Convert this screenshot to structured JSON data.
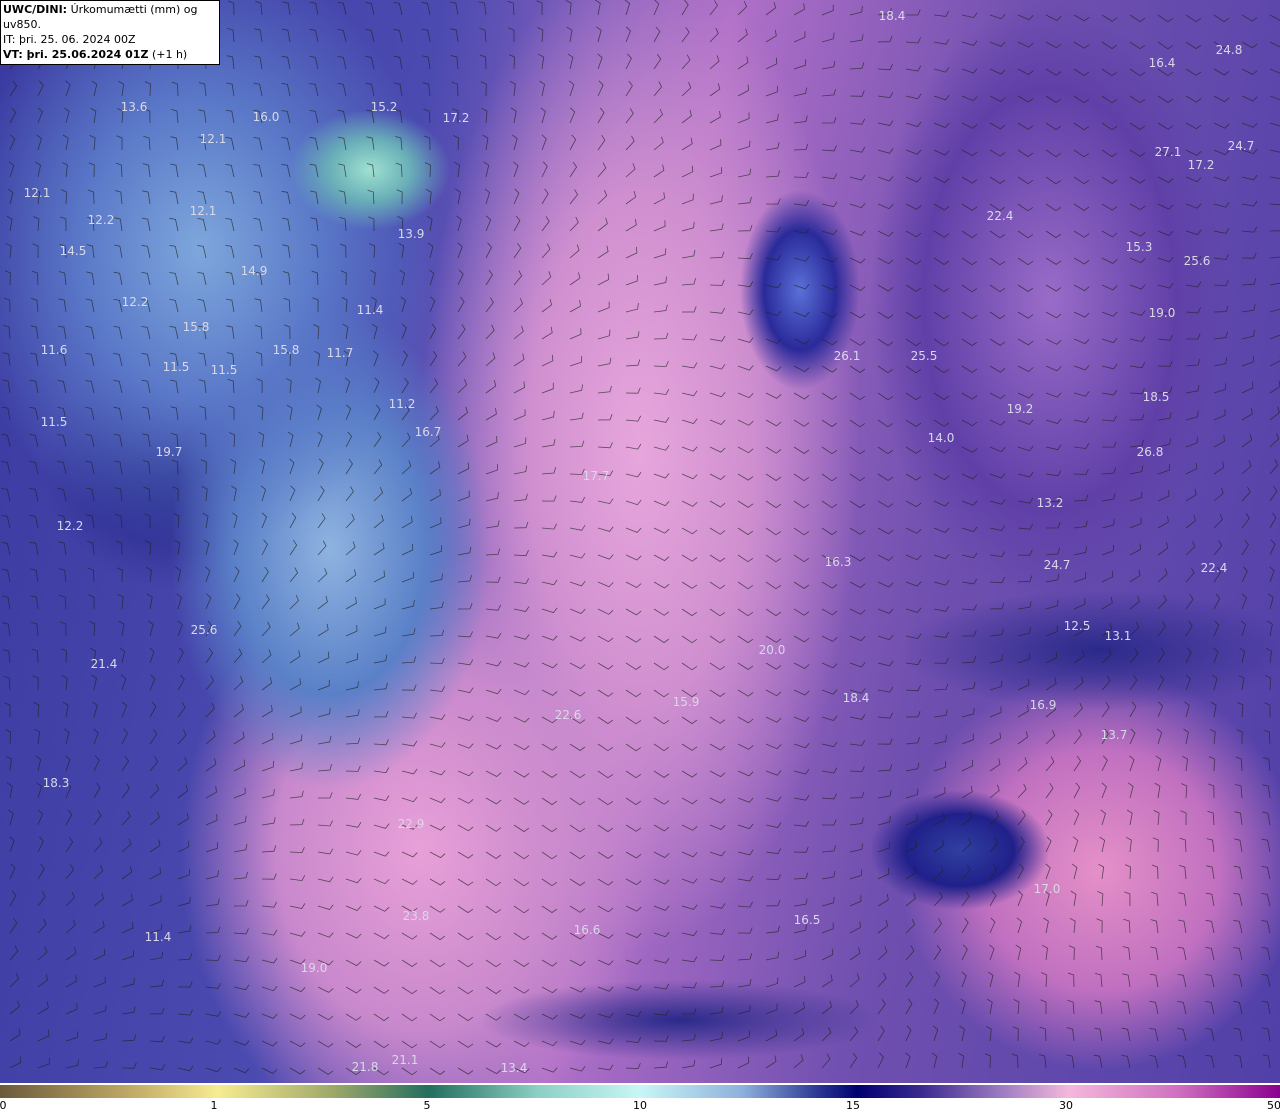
{
  "header": {
    "model": "UWC/DINI:",
    "title": "Úrkomumætti (mm) og uv850.",
    "it": "IT: þri. 25. 06. 2024 00Z",
    "vt_label": "VT: þri. 25.06.2024 01Z",
    "vt_offset": "(+1 h)"
  },
  "colorbar": {
    "ticks": [
      "0",
      "1",
      "5",
      "10",
      "15",
      "30",
      "50"
    ],
    "colors": [
      "#6b5a3a",
      "#f7ec90",
      "#236e5e",
      "#c8f6f6",
      "#000070",
      "#f4b8dc",
      "#8a0090"
    ]
  },
  "map_labels": [
    "18.4",
    "24.8",
    "16.4",
    "13.6",
    "16.0",
    "15.2",
    "17.2",
    "12.1",
    "27.1",
    "17.2",
    "24.7",
    "12.1",
    "12.2",
    "12.1",
    "13.9",
    "22.4",
    "14.5",
    "14.9",
    "15.3",
    "25.6",
    "12.2",
    "11.4",
    "19.0",
    "15.8",
    "11.6",
    "15.8",
    "11.7",
    "26.1",
    "25.5",
    "11.5",
    "11.5",
    "18.5",
    "11.2",
    "19.2",
    "11.5",
    "16.7",
    "14.0",
    "19.7",
    "26.8",
    "17.7",
    "13.2",
    "12.2",
    "16.3",
    "24.7",
    "22.4",
    "25.6",
    "12.5",
    "13.1",
    "21.4",
    "20.0",
    "18.4",
    "15.9",
    "16.9",
    "22.6",
    "13.7",
    "18.3",
    "22.9",
    "16.6",
    "16.5",
    "23.8",
    "17.0",
    "11.4",
    "19.0",
    "21.1",
    "21.8",
    "13.4"
  ]
}
